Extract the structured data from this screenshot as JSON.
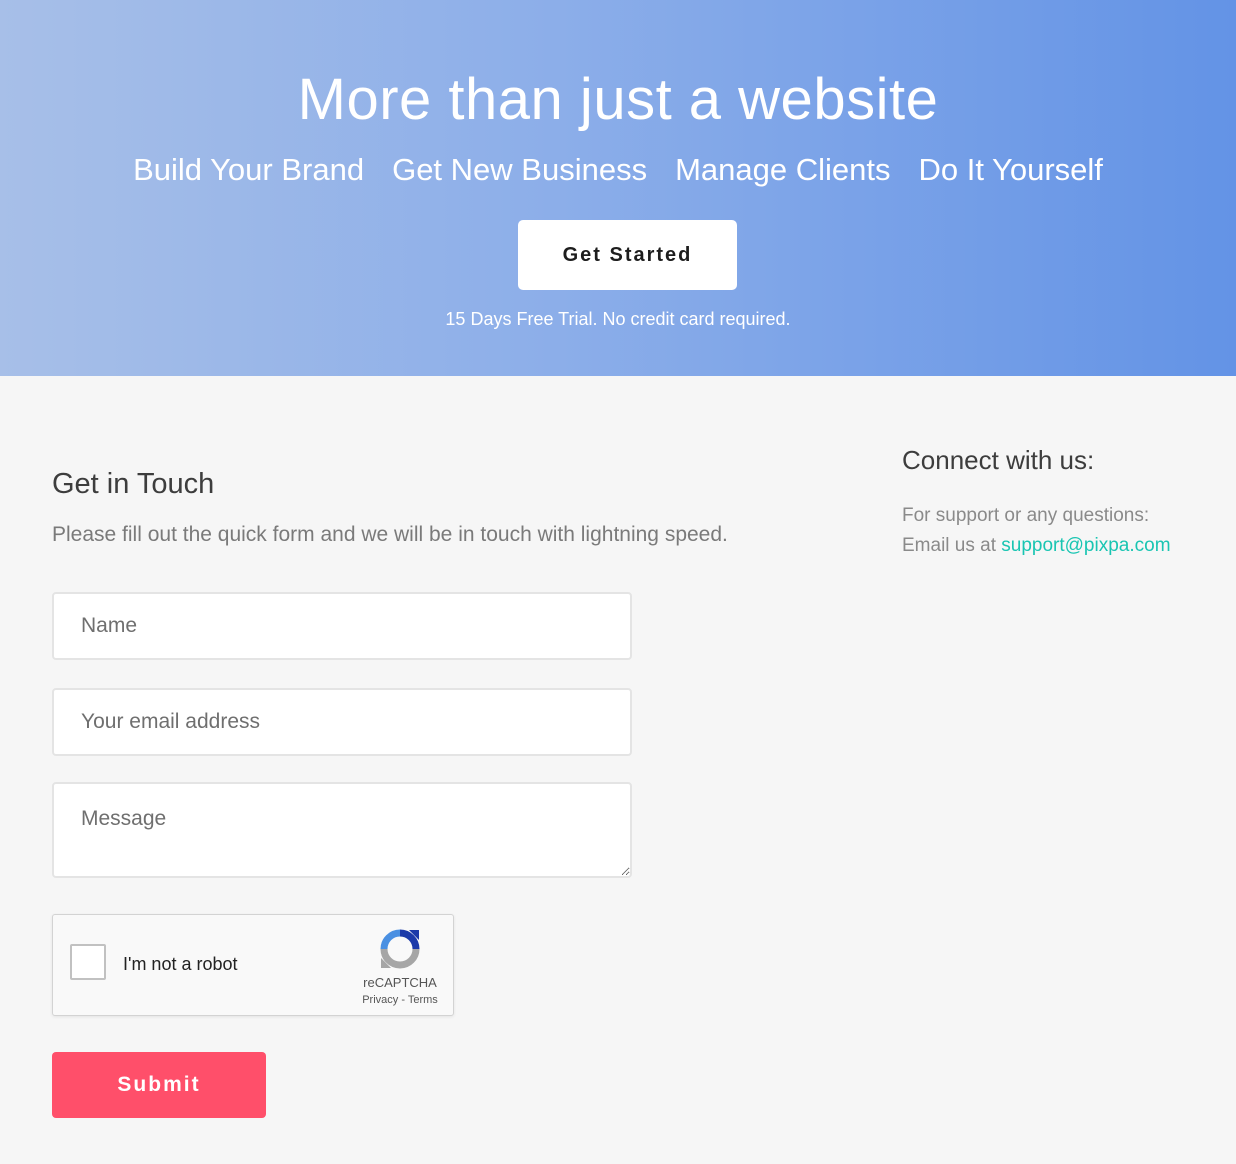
{
  "hero": {
    "title": "More than just a website",
    "taglines": [
      "Build Your Brand",
      "Get New Business",
      "Manage Clients",
      "Do It Yourself"
    ],
    "cta_label": "Get Started",
    "trial_note": "15 Days Free Trial. No credit card required."
  },
  "contact_form": {
    "title": "Get in Touch",
    "subtitle": "Please fill out the quick form and we will be in touch with lightning speed.",
    "name_placeholder": "Name",
    "email_placeholder": "Your email address",
    "message_placeholder": "Message",
    "recaptcha": {
      "label": "I'm not a robot",
      "brand": "reCAPTCHA",
      "privacy": "Privacy",
      "separator": " - ",
      "terms": "Terms"
    },
    "submit_label": "Submit"
  },
  "connect": {
    "title": "Connect with us:",
    "support_text": "For support or any questions:",
    "email_prefix": "Email us at ",
    "email": "support@pixpa.com"
  },
  "colors": {
    "hero_gradient_start": "#a7bfe8",
    "hero_gradient_end": "#6393e6",
    "submit": "#ff4f6a",
    "link": "#19c5b2",
    "page_background": "#f6f6f6"
  }
}
